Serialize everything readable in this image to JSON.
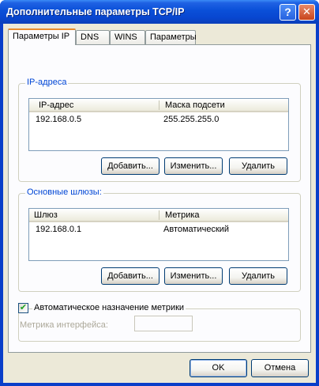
{
  "window": {
    "title": "Дополнительные параметры TCP/IP",
    "help_glyph": "?",
    "close_glyph": "✕"
  },
  "tabs": [
    {
      "label": "Параметры IP",
      "active": true
    },
    {
      "label": "DNS"
    },
    {
      "label": "WINS"
    },
    {
      "label": "Параметры"
    }
  ],
  "ip_group": {
    "legend": "IP-адреса",
    "columns": [
      "IP-адрес",
      "Маска подсети"
    ],
    "rows": [
      {
        "ip": "192.168.0.5",
        "mask": "255.255.255.0"
      }
    ],
    "add_label": "Добавить...",
    "edit_label": "Изменить...",
    "delete_label": "Удалить"
  },
  "gateway_group": {
    "legend": "Основные шлюзы:",
    "columns": [
      "Шлюз",
      "Метрика"
    ],
    "rows": [
      {
        "gateway": "192.168.0.1",
        "metric": "Автоматический"
      }
    ],
    "add_label": "Добавить...",
    "edit_label": "Изменить...",
    "delete_label": "Удалить"
  },
  "auto_metric": {
    "label": "Автоматическое назначение метрики",
    "checked": true,
    "check_glyph": "✔"
  },
  "interface_metric": {
    "label": "Метрика интерфейса:",
    "value": ""
  },
  "footer": {
    "ok_label": "OK",
    "cancel_label": "Отмена"
  },
  "colors": {
    "titlebar": "#0a4fd8",
    "client": "#ece9d8",
    "legend_text": "#0046d5",
    "tab_accent": "#e68b2c"
  }
}
